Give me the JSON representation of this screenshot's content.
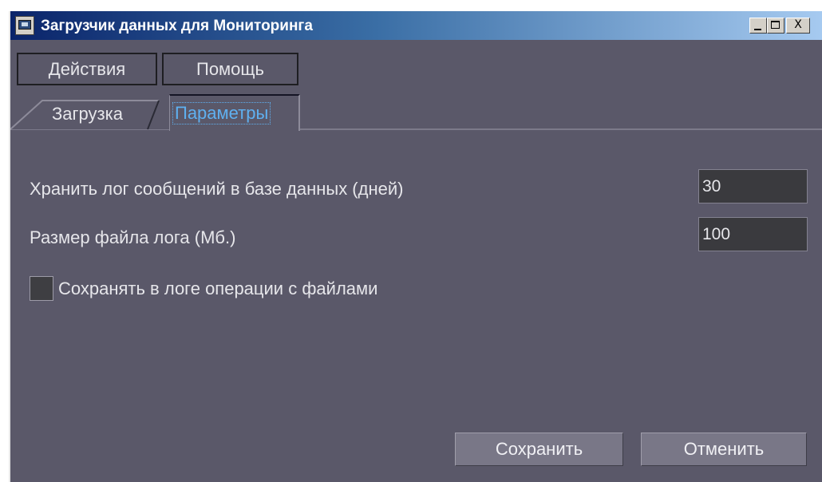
{
  "window": {
    "title": "Загрузчик данных для Мониторинга",
    "title_icon": "monitor-app-icon",
    "background_color": "#5a5869",
    "title_bar_gradient": [
      "#0a246a",
      "#3a6ea5",
      "#a6caf0"
    ],
    "controls": {
      "minimize_icon": "minimize-icon",
      "maximize_icon": "maximize-icon",
      "close_glyph": "X"
    }
  },
  "menu": {
    "actions_label": "Действия",
    "help_label": "Помощь"
  },
  "tabs": [
    {
      "label": "Загрузка",
      "active": false
    },
    {
      "label": "Параметры",
      "active": true
    }
  ],
  "active_tab_color": "#5fb0f0",
  "settings": {
    "keep_log_label": "Хранить лог сообщений в базе данных (дней)",
    "keep_log_value": "30",
    "file_size_label": "Размер файла лога (Мб.)",
    "file_size_value": "100",
    "file_ops_checkbox_label": "Сохранять в логе операции с файлами",
    "file_ops_checked": false
  },
  "buttons": {
    "save_label": "Сохранить",
    "cancel_label": "Отменить"
  }
}
